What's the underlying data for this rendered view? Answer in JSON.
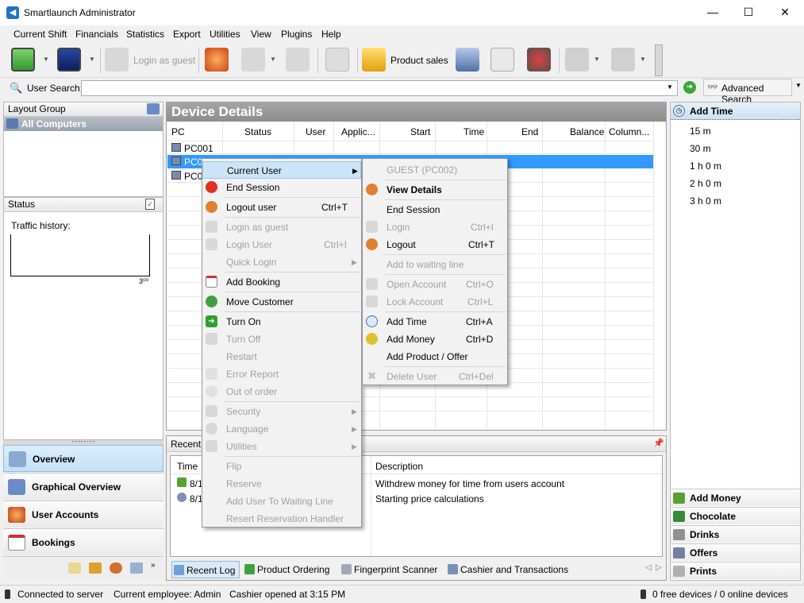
{
  "window": {
    "title": "Smartlaunch Administrator",
    "minimize": "—",
    "maximize": "☐",
    "close": "✕"
  },
  "menubar": [
    "Current Shift",
    "Financials",
    "Statistics",
    "Export",
    "Utilities",
    "View",
    "Plugins",
    "Help"
  ],
  "toolbar": {
    "login_as_guest": "Login as guest",
    "product_sales": "Product sales"
  },
  "search": {
    "label": "User Search:",
    "value": "",
    "advanced": "Advanced Search"
  },
  "left": {
    "layout_group": "Layout Group",
    "all_computers": "All Computers",
    "status": "Status",
    "traffic_history": "Traffic history:",
    "traffic_value": "3⁰⁰",
    "nav": [
      "Overview",
      "Graphical Overview",
      "User Accounts",
      "Bookings"
    ]
  },
  "device_details": {
    "title": "Device Details",
    "columns": [
      "PC",
      "Status",
      "User",
      "Applic...",
      "Start",
      "Time",
      "End",
      "Balance",
      "Column..."
    ],
    "rows": [
      "PC001",
      "PC00",
      "PC00"
    ]
  },
  "recent": {
    "title": "Recent",
    "columns": [
      "Time",
      "Description"
    ],
    "rows": [
      {
        "time": "8/1",
        "description": "Withdrew money for time from users account"
      },
      {
        "time": "8/1",
        "description": "Starting price calculations"
      }
    ],
    "tabs": [
      "Recent Log",
      "Product Ordering",
      "Fingerprint Scanner",
      "Cashier and Transactions"
    ]
  },
  "right": {
    "header": "Add Time",
    "items": [
      "15 m",
      "30 m",
      "1 h 0 m",
      "2 h 0 m",
      "3 h 0 m"
    ],
    "buttons": [
      "Add Money",
      "Chocolate",
      "Drinks",
      "Offers",
      "Prints"
    ]
  },
  "context_menu": {
    "items": [
      {
        "label": "Current User",
        "shortcut": "",
        "disabled": false,
        "submenu": true
      },
      {
        "label": "End Session",
        "shortcut": "",
        "disabled": false
      },
      {
        "label": "Logout user",
        "shortcut": "Ctrl+T",
        "disabled": false
      },
      {
        "label": "Login as guest",
        "shortcut": "",
        "disabled": true
      },
      {
        "label": "Login User",
        "shortcut": "Ctrl+I",
        "disabled": true
      },
      {
        "label": "Quick Login",
        "shortcut": "",
        "disabled": true,
        "submenu": true
      },
      {
        "label": "Add Booking",
        "shortcut": "",
        "disabled": false
      },
      {
        "label": "Move Customer",
        "shortcut": "",
        "disabled": false
      },
      {
        "label": "Turn On",
        "shortcut": "",
        "disabled": false
      },
      {
        "label": "Turn Off",
        "shortcut": "",
        "disabled": true
      },
      {
        "label": "Restart",
        "shortcut": "",
        "disabled": true
      },
      {
        "label": "Error Report",
        "shortcut": "",
        "disabled": true
      },
      {
        "label": "Out of order",
        "shortcut": "",
        "disabled": true
      },
      {
        "label": "Security",
        "shortcut": "",
        "disabled": true,
        "submenu": true
      },
      {
        "label": "Language",
        "shortcut": "",
        "disabled": true,
        "submenu": true
      },
      {
        "label": "Utilities",
        "shortcut": "",
        "disabled": true,
        "submenu": true
      },
      {
        "label": "Flip",
        "shortcut": "",
        "disabled": true
      },
      {
        "label": "Reserve",
        "shortcut": "",
        "disabled": true
      },
      {
        "label": "Add User To Waiting Line",
        "shortcut": "",
        "disabled": true
      },
      {
        "label": "Resert Reservation Handler",
        "shortcut": "",
        "disabled": true
      }
    ]
  },
  "sub_menu": {
    "items": [
      {
        "label": "GUEST (PC002)",
        "shortcut": "",
        "disabled": true
      },
      {
        "label": "View Details",
        "shortcut": "",
        "disabled": false
      },
      {
        "label": "End Session",
        "shortcut": "",
        "disabled": false
      },
      {
        "label": "Login",
        "shortcut": "Ctrl+I",
        "disabled": true
      },
      {
        "label": "Logout",
        "shortcut": "Ctrl+T",
        "disabled": false
      },
      {
        "label": "Add to waiting line",
        "shortcut": "",
        "disabled": true
      },
      {
        "label": "Open Account",
        "shortcut": "Ctrl+O",
        "disabled": true
      },
      {
        "label": "Lock Account",
        "shortcut": "Ctrl+L",
        "disabled": true
      },
      {
        "label": "Add Time",
        "shortcut": "Ctrl+A",
        "disabled": false
      },
      {
        "label": "Add Money",
        "shortcut": "Ctrl+D",
        "disabled": false
      },
      {
        "label": "Add Product / Offer",
        "shortcut": "",
        "disabled": false
      },
      {
        "label": "Delete User",
        "shortcut": "Ctrl+Del",
        "disabled": true
      }
    ]
  },
  "statusbar": {
    "connected": "Connected to server",
    "employee": "Current employee: Admin",
    "cashier": "Cashier opened at 3:15 PM",
    "devices": "0 free devices / 0 online devices"
  },
  "colors": {
    "selection": "#3399ff",
    "menu_highlight": "#cce4f7",
    "header_gray": "#9a9a9a"
  }
}
